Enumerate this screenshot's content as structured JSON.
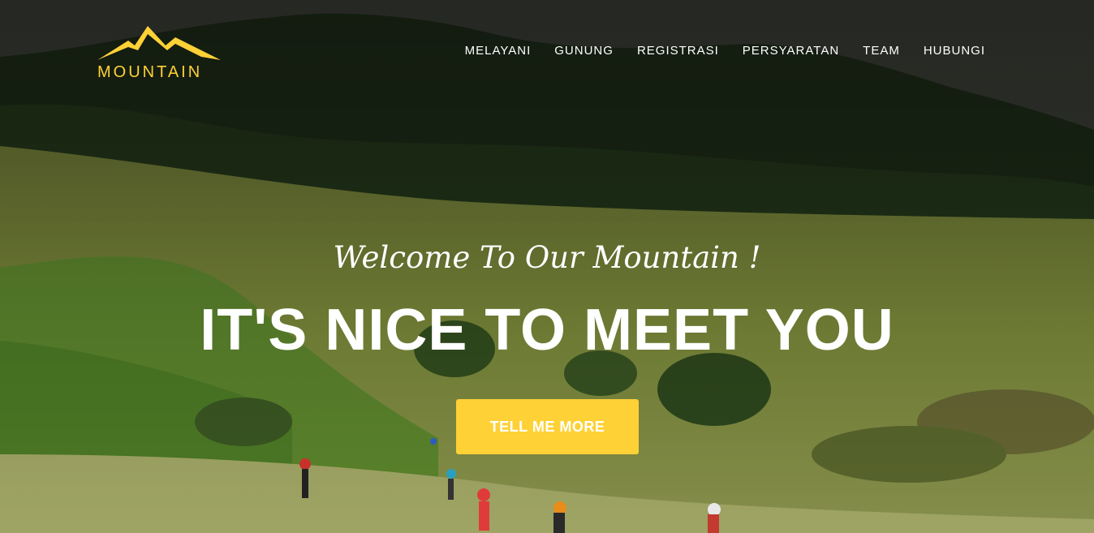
{
  "brand": {
    "logo_text": "MOUNTAIN",
    "accent": "#fed136"
  },
  "nav": {
    "items": [
      {
        "label": "MELAYANI"
      },
      {
        "label": "GUNUNG"
      },
      {
        "label": "REGISTRASI"
      },
      {
        "label": "PERSYARATAN"
      },
      {
        "label": "TEAM"
      },
      {
        "label": "HUBUNGI"
      }
    ]
  },
  "hero": {
    "subheading": "Welcome To Our Mountain !",
    "heading": "IT'S NICE TO MEET YOU",
    "cta_label": "TELL ME MORE",
    "background": "mountain-meadow-photo"
  }
}
